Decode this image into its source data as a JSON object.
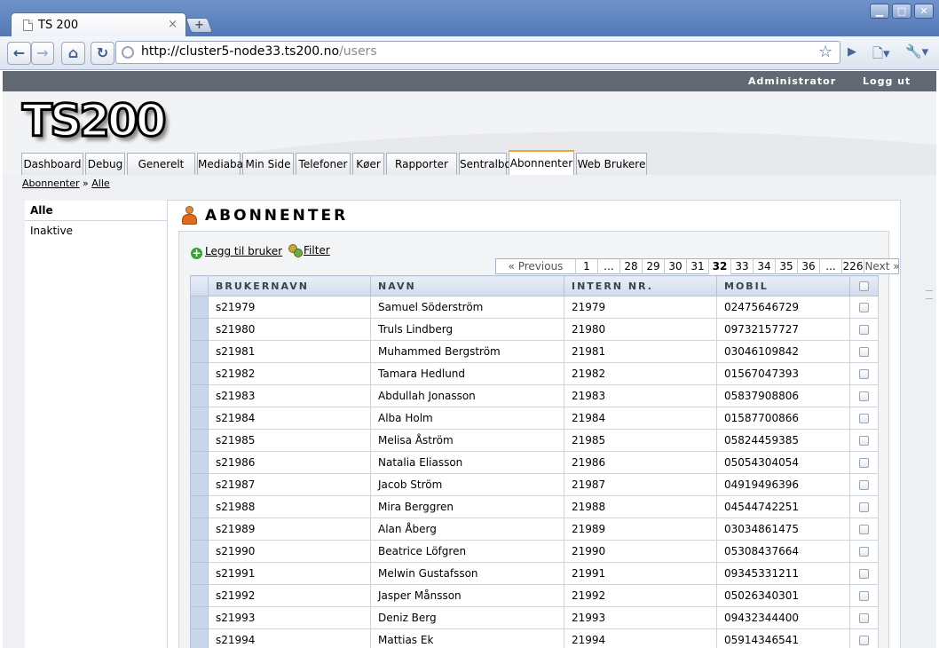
{
  "browser": {
    "tab_title": "TS 200",
    "tab_close": "×",
    "new_tab": "+",
    "window_min": "▁",
    "window_max": "□",
    "window_close": "✕",
    "url_host": "http://cluster5-node33.ts200.no",
    "url_path": "/users",
    "icons": {
      "back": "←",
      "forward": "→",
      "home": "⌂",
      "reload": "↻",
      "star": "☆",
      "play": "▶",
      "page": "🗋▾",
      "wrench": "🔧▾"
    }
  },
  "topbar": {
    "admin": "Administrator",
    "logout": "Logg ut"
  },
  "logo": "TS200",
  "nav_tabs": [
    "Dashboard",
    "Debug",
    "Generelt",
    "Mediabank",
    "Min Side",
    "Telefoner",
    "Køer",
    "Rapporter",
    "Sentralbord",
    "Abonnenter",
    "Web Brukere"
  ],
  "active_tab": "Abonnenter",
  "breadcrumb": {
    "root": "Abonnenter",
    "sep": " » ",
    "current": "Alle"
  },
  "sidebar": [
    "Alle",
    "Inaktive"
  ],
  "page_title": "ABONNENTER",
  "actions": {
    "add_user": "Legg til bruker",
    "add_icon": "+",
    "filter": "Filter"
  },
  "pager": {
    "prev": "« Previous",
    "pages": [
      "1",
      "...",
      "28",
      "29",
      "30",
      "31",
      "32",
      "33",
      "34",
      "35",
      "36",
      "...",
      "226"
    ],
    "current": "32",
    "next": "Next »"
  },
  "table": {
    "columns": [
      "BRUKERNAVN",
      "NAVN",
      "INTERN NR.",
      "MOBIL"
    ],
    "rows": [
      [
        "s21979",
        "Samuel Söderström",
        "21979",
        "02475646729"
      ],
      [
        "s21980",
        "Truls Lindberg",
        "21980",
        "09732157727"
      ],
      [
        "s21981",
        "Muhammed Bergström",
        "21981",
        "03046109842"
      ],
      [
        "s21982",
        "Tamara Hedlund",
        "21982",
        "01567047393"
      ],
      [
        "s21983",
        "Abdullah Jonasson",
        "21983",
        "05837908806"
      ],
      [
        "s21984",
        "Alba Holm",
        "21984",
        "01587700866"
      ],
      [
        "s21985",
        "Melisa Åström",
        "21985",
        "05824459385"
      ],
      [
        "s21986",
        "Natalia Eliasson",
        "21986",
        "05054304054"
      ],
      [
        "s21987",
        "Jacob Ström",
        "21987",
        "04919496396"
      ],
      [
        "s21988",
        "Mira Berggren",
        "21988",
        "04544742251"
      ],
      [
        "s21989",
        "Alan Åberg",
        "21989",
        "03034861475"
      ],
      [
        "s21990",
        "Beatrice Löfgren",
        "21990",
        "05308437664"
      ],
      [
        "s21991",
        "Melwin Gustafsson",
        "21991",
        "09345331211"
      ],
      [
        "s21992",
        "Jasper Månsson",
        "21992",
        "05026340301"
      ],
      [
        "s21993",
        "Deniz Berg",
        "21993",
        "09432344400"
      ],
      [
        "s21994",
        "Mattias Ek",
        "21994",
        "05914346541"
      ]
    ]
  }
}
